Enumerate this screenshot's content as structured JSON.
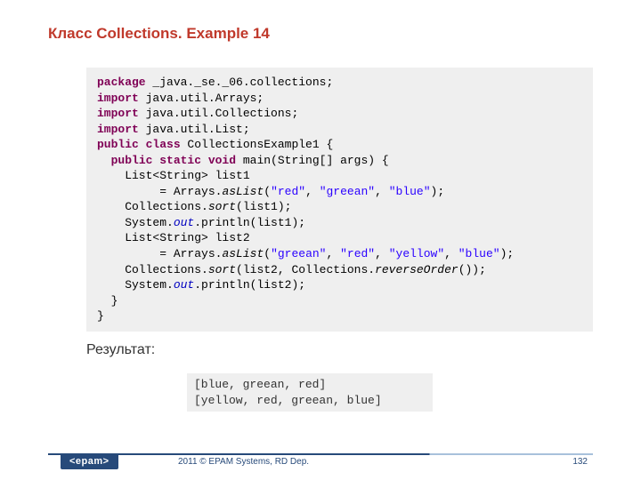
{
  "title": "Класс  Collections. Example 14",
  "code": {
    "l1a": "package",
    "l1b": " _java._se._06.collections;",
    "l2a": "import",
    "l2b": " java.util.Arrays;",
    "l3a": "import",
    "l3b": " java.util.Collections;",
    "l4a": "import",
    "l4b": " java.util.List;",
    "l5a": "public class",
    "l5b": " CollectionsExample1 {",
    "l6a": "  ",
    "l6b": "public static void",
    "l6c": " main(String[] args) {",
    "l7": "    List<String> list1",
    "l8a": "         = Arrays.",
    "l8b": "asList",
    "l8c": "(",
    "l8d": "\"red\"",
    "l8e": ", ",
    "l8f": "\"greean\"",
    "l8g": ", ",
    "l8h": "\"blue\"",
    "l8i": ");",
    "l9a": "    Collections.",
    "l9b": "sort",
    "l9c": "(list1);",
    "l10a": "    System.",
    "l10b": "out",
    "l10c": ".println(list1);",
    "l11": "    List<String> list2",
    "l12a": "         = Arrays.",
    "l12b": "asList",
    "l12c": "(",
    "l12d": "\"greean\"",
    "l12e": ", ",
    "l12f": "\"red\"",
    "l12g": ", ",
    "l12h": "\"yellow\"",
    "l12i": ", ",
    "l12j": "\"blue\"",
    "l12k": ");",
    "l13a": "    Collections.",
    "l13b": "sort",
    "l13c": "(list2, Collections.",
    "l13d": "reverseOrder",
    "l13e": "());",
    "l14a": "    System.",
    "l14b": "out",
    "l14c": ".println(list2);",
    "l15": "  }",
    "l16": "}"
  },
  "result_label": "Результат:",
  "output": {
    "o1": "[blue, greean, red]",
    "o2": "[yellow, red, greean, blue]"
  },
  "footer": {
    "logo": "<epam>",
    "copyright": "2011 © EPAM Systems, RD Dep.",
    "page": "132"
  }
}
